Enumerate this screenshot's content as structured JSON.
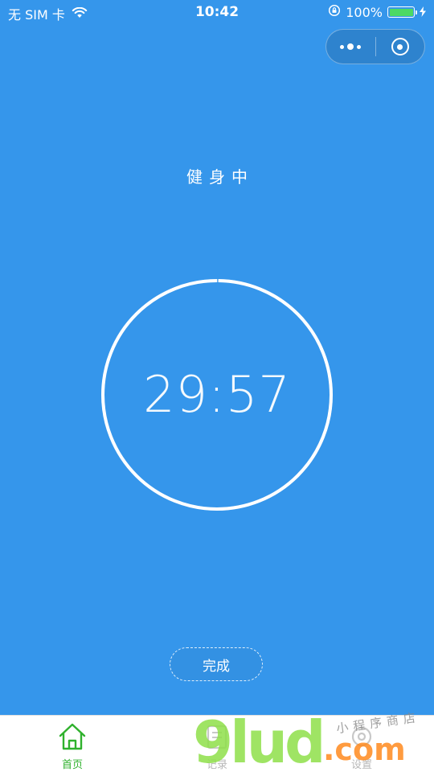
{
  "status_bar": {
    "carrier": "无 SIM 卡",
    "time": "10:42",
    "battery_percent": "100%",
    "battery_level": 1.0
  },
  "capsule": {
    "more_icon": "more-dots-icon",
    "close_icon": "target-circle-icon"
  },
  "main": {
    "title": "健身中",
    "timer": "29:57",
    "progress": 0.998,
    "finish_label": "完成"
  },
  "tab_bar": {
    "items": [
      {
        "label": "首页",
        "icon": "home-icon",
        "active": true
      },
      {
        "label": "记录",
        "icon": "record-icon",
        "active": false
      },
      {
        "label": "设置",
        "icon": "settings-icon",
        "active": false
      }
    ]
  },
  "watermark": {
    "main": "9lud",
    "com": ".com",
    "small": "小程序商店"
  },
  "colors": {
    "background": "#3596eb",
    "tab_active": "#2fb12d",
    "tab_inactive": "#b8b8b8"
  }
}
